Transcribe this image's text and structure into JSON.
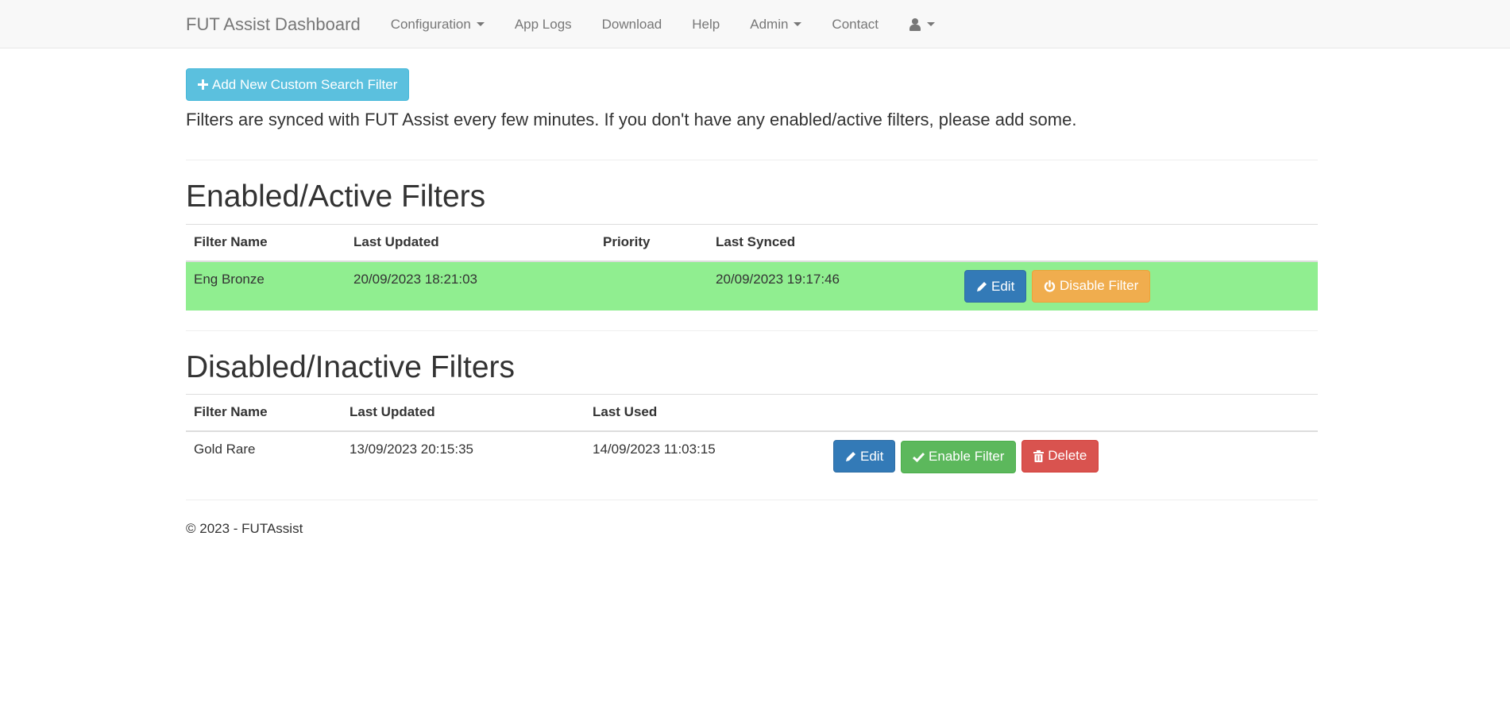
{
  "navbar": {
    "brand": "FUT Assist Dashboard",
    "items": [
      {
        "label": "Configuration",
        "dropdown": true
      },
      {
        "label": "App Logs",
        "dropdown": false
      },
      {
        "label": "Download",
        "dropdown": false
      },
      {
        "label": "Help",
        "dropdown": false
      },
      {
        "label": "Admin",
        "dropdown": true
      },
      {
        "label": "Contact",
        "dropdown": false
      }
    ],
    "user_menu": {
      "icon": "user-icon",
      "dropdown": true
    }
  },
  "main": {
    "add_button": {
      "label": "Add New Custom Search Filter",
      "icon": "plus-icon"
    },
    "intro_text": "Filters are synced with FUT Assist every few minutes. If you don't have any enabled/active filters, please add some."
  },
  "active_filters": {
    "title": "Enabled/Active Filters",
    "columns": [
      "Filter Name",
      "Last Updated",
      "Priority",
      "Last Synced",
      ""
    ],
    "rows": [
      {
        "name": "Eng Bronze",
        "last_updated": "20/09/2023 18:21:03",
        "priority": "",
        "last_synced": "20/09/2023 19:17:46",
        "edit_label": "Edit",
        "disable_label": "Disable Filter"
      }
    ],
    "row_color": "#90ee90"
  },
  "inactive_filters": {
    "title": "Disabled/Inactive Filters",
    "columns": [
      "Filter Name",
      "Last Updated",
      "Last Used",
      ""
    ],
    "rows": [
      {
        "name": "Gold Rare",
        "last_updated": "13/09/2023 20:15:35",
        "last_used": "14/09/2023 11:03:15",
        "edit_label": "Edit",
        "enable_label": "Enable Filter",
        "delete_label": "Delete"
      }
    ]
  },
  "footer": {
    "text": "© 2023 - FUTAssist"
  },
  "colors": {
    "info": "#5bc0de",
    "primary": "#337ab7",
    "warning": "#f0ad4e",
    "success": "#5cb85c",
    "danger": "#d9534f"
  }
}
